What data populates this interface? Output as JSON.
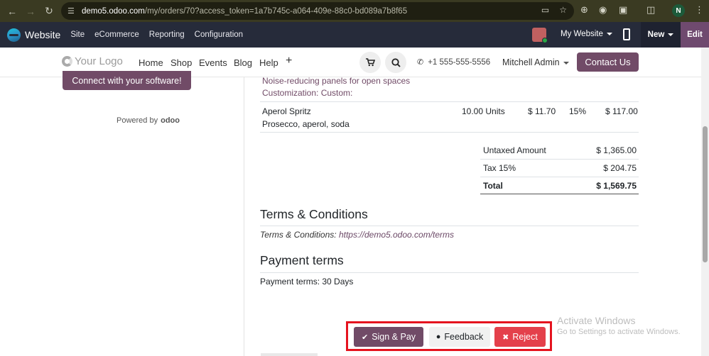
{
  "browser": {
    "url_host": "demo5.odoo.com",
    "url_rest": "/my/orders/70?access_token=1a7b745c-a064-409e-88c0-bd089a7b8f65",
    "profile_initial": "N"
  },
  "odoo_nav": {
    "app_name": "Website",
    "items": [
      "Site",
      "eCommerce",
      "Reporting",
      "Configuration"
    ],
    "my_website": "My Website",
    "new_label": "New",
    "edit_label": "Edit"
  },
  "site_header": {
    "logo": "Your Logo",
    "menu": [
      "Home",
      "Shop",
      "Events",
      "Blog",
      "Help"
    ],
    "plus": "+",
    "phone": "+1 555-555-5556",
    "user": "Mitchell Admin",
    "contact": "Contact Us"
  },
  "sidebar": {
    "connect_button": "Connect with your software!",
    "powered_by": "Powered by",
    "powered_brand": "odoo"
  },
  "order": {
    "prev_line": {
      "desc1": "Noise-reducing panels for open spaces",
      "desc2": "Customization: Custom:"
    },
    "line": {
      "product": "Aperol Spritz",
      "description": "Prosecco, aperol, soda",
      "quantity": "10.00 Units",
      "unit_price": "$ 11.70",
      "tax": "15%",
      "amount": "$ 117.00"
    },
    "totals": [
      {
        "label": "Untaxed Amount",
        "value": "$ 1,365.00"
      },
      {
        "label": "Tax 15%",
        "value": "$ 204.75"
      },
      {
        "label": "Total",
        "value": "$ 1,569.75"
      }
    ]
  },
  "terms": {
    "heading": "Terms & Conditions",
    "prefix": "Terms & Conditions:",
    "link": "https://demo5.odoo.com/terms"
  },
  "payment_terms": {
    "heading": "Payment terms",
    "text": "Payment terms: 30 Days"
  },
  "actions": {
    "sign_pay": "Sign & Pay",
    "feedback": "Feedback",
    "reject": "Reject"
  },
  "watermark": {
    "line1": "Activate Windows",
    "line2": "Go to Settings to activate Windows."
  }
}
